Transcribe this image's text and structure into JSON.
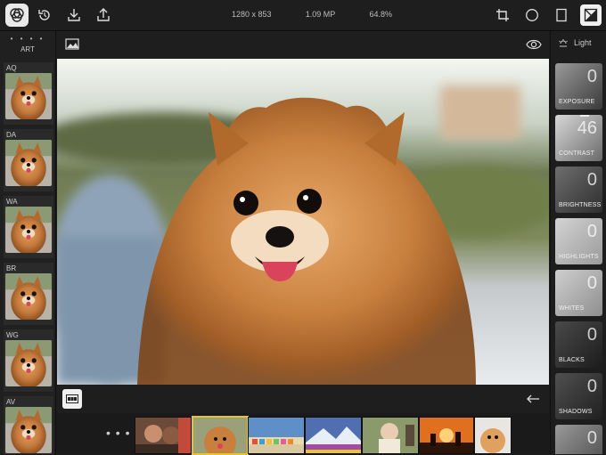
{
  "toolbar": {
    "resolution": "1280 x 853",
    "megapixels": "1.09 MP",
    "zoom": "64.8%",
    "icons": [
      "app-logo-icon",
      "history-icon",
      "import-icon",
      "share-icon",
      "crop-icon",
      "vignette-icon",
      "frame-icon",
      "adjust-icon"
    ]
  },
  "left_panel": {
    "category": "ART",
    "presets": [
      {
        "code": "AQ"
      },
      {
        "code": "DA"
      },
      {
        "code": "WA"
      },
      {
        "code": "BR"
      },
      {
        "code": "WG"
      },
      {
        "code": "AV"
      }
    ]
  },
  "filmstrip": {
    "more": "• • •",
    "selected_index": 1
  },
  "right_panel": {
    "section": "Light",
    "adjustments": [
      {
        "name": "EXPOSURE",
        "value": "0"
      },
      {
        "name": "CONTRAST",
        "value": "46"
      },
      {
        "name": "BRIGHTNESS",
        "value": "0"
      },
      {
        "name": "HIGHLIGHTS",
        "value": "0"
      },
      {
        "name": "WHITES",
        "value": "0"
      },
      {
        "name": "BLACKS",
        "value": "0"
      },
      {
        "name": "SHADOWS",
        "value": "0"
      },
      {
        "name": "",
        "value": "0"
      }
    ]
  },
  "colors": {
    "selection": "#e6c52a",
    "panel": "#1e1e1e"
  }
}
